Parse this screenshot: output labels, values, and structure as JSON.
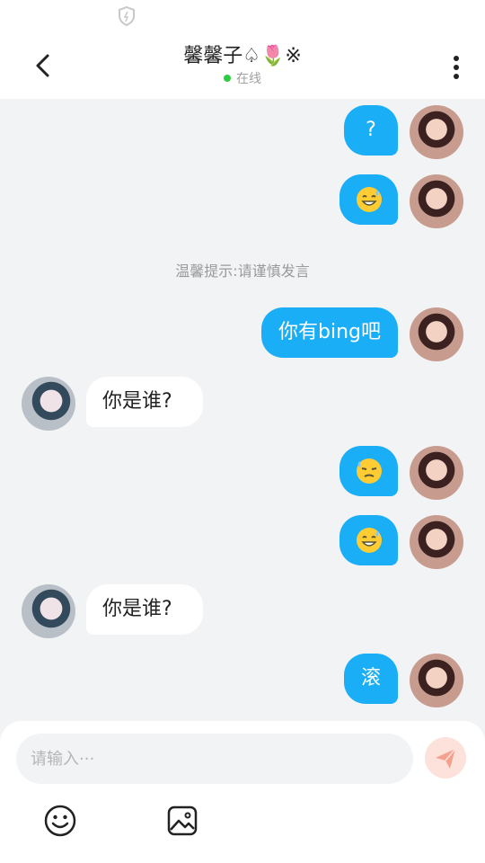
{
  "header": {
    "title": "馨馨子♤🌷※",
    "status": "在线"
  },
  "messages": [
    {
      "side": "me",
      "text": "?"
    },
    {
      "side": "me",
      "emoji": "grinning-sweat"
    },
    {
      "tip": "温馨提示:请谨慎发言"
    },
    {
      "side": "me",
      "text": "你有bing吧"
    },
    {
      "side": "other",
      "text": "你是谁?"
    },
    {
      "side": "me",
      "emoji": "downcast-sweat"
    },
    {
      "side": "me",
      "emoji": "grinning-sweat"
    },
    {
      "side": "other",
      "text": "你是谁?"
    },
    {
      "side": "me",
      "text": "滚"
    }
  ],
  "chat": {
    "msg0": "?",
    "tip": "温馨提示:请谨慎发言",
    "msg3": "你有bing吧",
    "msg4": "你是谁?",
    "msg7": "你是谁?",
    "msg8": "滚"
  },
  "input": {
    "placeholder": "请输入···",
    "value": ""
  },
  "icons": {
    "status": "shield-icon",
    "back": "chevron-left-icon",
    "more": "more-vertical-icon",
    "send": "send-icon",
    "emoji": "smiley-icon",
    "image": "image-icon"
  },
  "colors": {
    "my_bubble": "#1aaef6",
    "online": "#2ecc40",
    "send_button": "#fde2dc",
    "send_icon": "#f6a08e"
  }
}
